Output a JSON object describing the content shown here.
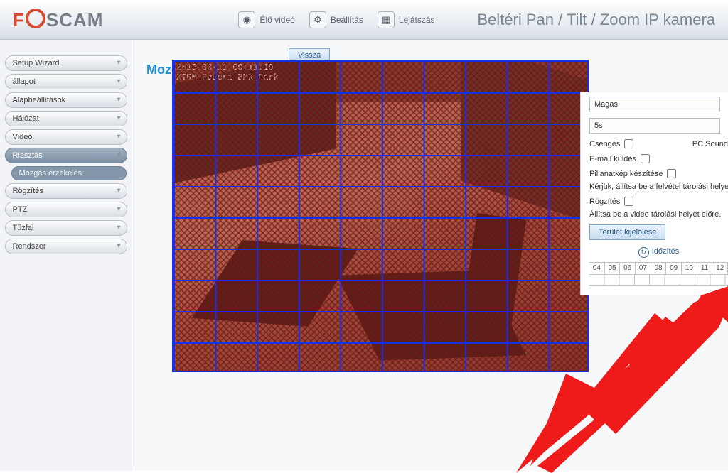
{
  "logo": {
    "part1": "F",
    "part2": "SCAM"
  },
  "tabs": {
    "live": "Élő videó",
    "settings": "Beállítás",
    "playback": "Lejátszás"
  },
  "camera_title": "Beltéri Pan / Tilt / Zoom IP kamera",
  "sidebar": {
    "items": [
      {
        "label": "Setup Wizard"
      },
      {
        "label": "állapot"
      },
      {
        "label": "Alapbeállítások"
      },
      {
        "label": "Hálózat"
      },
      {
        "label": "Videó"
      },
      {
        "label": "Riasztás",
        "selected": true
      },
      {
        "label": "Rögzítés"
      },
      {
        "label": "PTZ"
      },
      {
        "label": "Tűzfal"
      },
      {
        "label": "Rendszer"
      }
    ],
    "subitem": "Mozgás érzékelés"
  },
  "section_label": "Mozg",
  "back_button": "Vissza",
  "video_overlay": {
    "timestamp": "2015-03-11 09:11:19",
    "location": "XTRM_Federi_BMX_Park"
  },
  "settings": {
    "sensitivity": "Magas",
    "interval": "5s",
    "ring_label": "Csengés",
    "pcsound_label": "PC Sound",
    "email_label": "E-mail küldés",
    "snapshot_label": "Pillanatkép készítése",
    "snapshot_hint": "Kérjük, állítsa be a felvétel tárolási helyet",
    "record_label": "Rögzítés",
    "record_hint": "Állítsa be a video tárolási helyet előre.",
    "area_button": "Terület kijelölése",
    "schedule_label": "Időzítés",
    "hours": [
      "04",
      "05",
      "06",
      "07",
      "08",
      "09",
      "10",
      "11",
      "12"
    ]
  }
}
